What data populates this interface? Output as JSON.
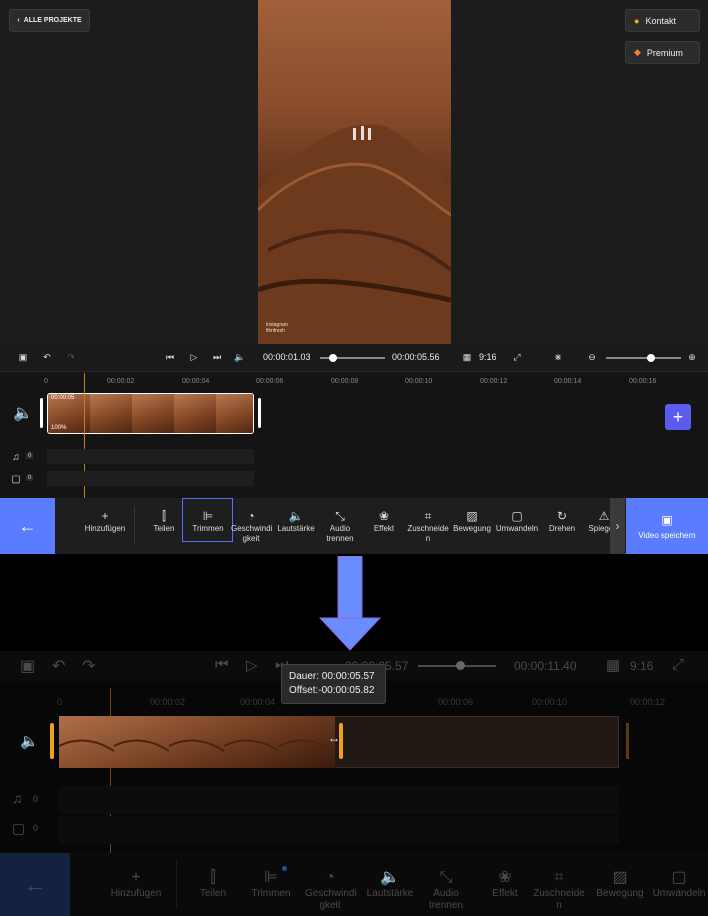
{
  "top_bar": {
    "back_label": "ALLE PROJEKTE",
    "contact_label": "Kontakt",
    "premium_label": "Premium"
  },
  "preview": {
    "watermark_line1": "instagram",
    "watermark_line2": "filmfresh"
  },
  "playback": {
    "current_time": "00:00:01.03",
    "total_time": "00:00:05.56",
    "progress": 0.2,
    "aspect": "9:16",
    "zoom": 0.6
  },
  "ruler": [
    "0",
    "00:00:02",
    "00:00:04",
    "00:00:06",
    "00:00:08",
    "00:00:10",
    "00:00:12",
    "00:00:14",
    "00:00:16"
  ],
  "clip": {
    "duration": "00:00:05",
    "volume": "100%"
  },
  "tracks": {
    "music_count": "0",
    "sticker_count": "0"
  },
  "tools": [
    "Hinzufügen",
    "Teilen",
    "Trimmen",
    "Geschwindi gkeit",
    "Lautstärke",
    "Audio trennen",
    "Effekt",
    "Zuschneide n",
    "Bewegung",
    "Umwandeln",
    "Drehen",
    "Spiegeln"
  ],
  "save_label": "Video speichern",
  "zoomed": {
    "current_time": "00:00:05.57",
    "total_time": "00:00:11.40",
    "aspect": "9:16",
    "tooltip_duration": "Dauer: 00:00:05.57",
    "tooltip_offset": "Offset:-00:00:05.82",
    "ruler": [
      "0",
      "00:00:02",
      "00:00:04",
      "00:00:06",
      "00:00:08",
      "00:00:10",
      "00:00:12"
    ],
    "music_count": "0",
    "sticker_count": "0",
    "tools": [
      "Hinzufügen",
      "Teilen",
      "Trimmen",
      "Geschwindi gkeit",
      "Lautstärke",
      "Audio trennen",
      "Effekt",
      "Zuschneide n",
      "Bewegung",
      "Umwandeln"
    ]
  },
  "colors": {
    "accent": "#5b7cff",
    "marker": "#f0a020",
    "arrow": "#6b8cff"
  }
}
